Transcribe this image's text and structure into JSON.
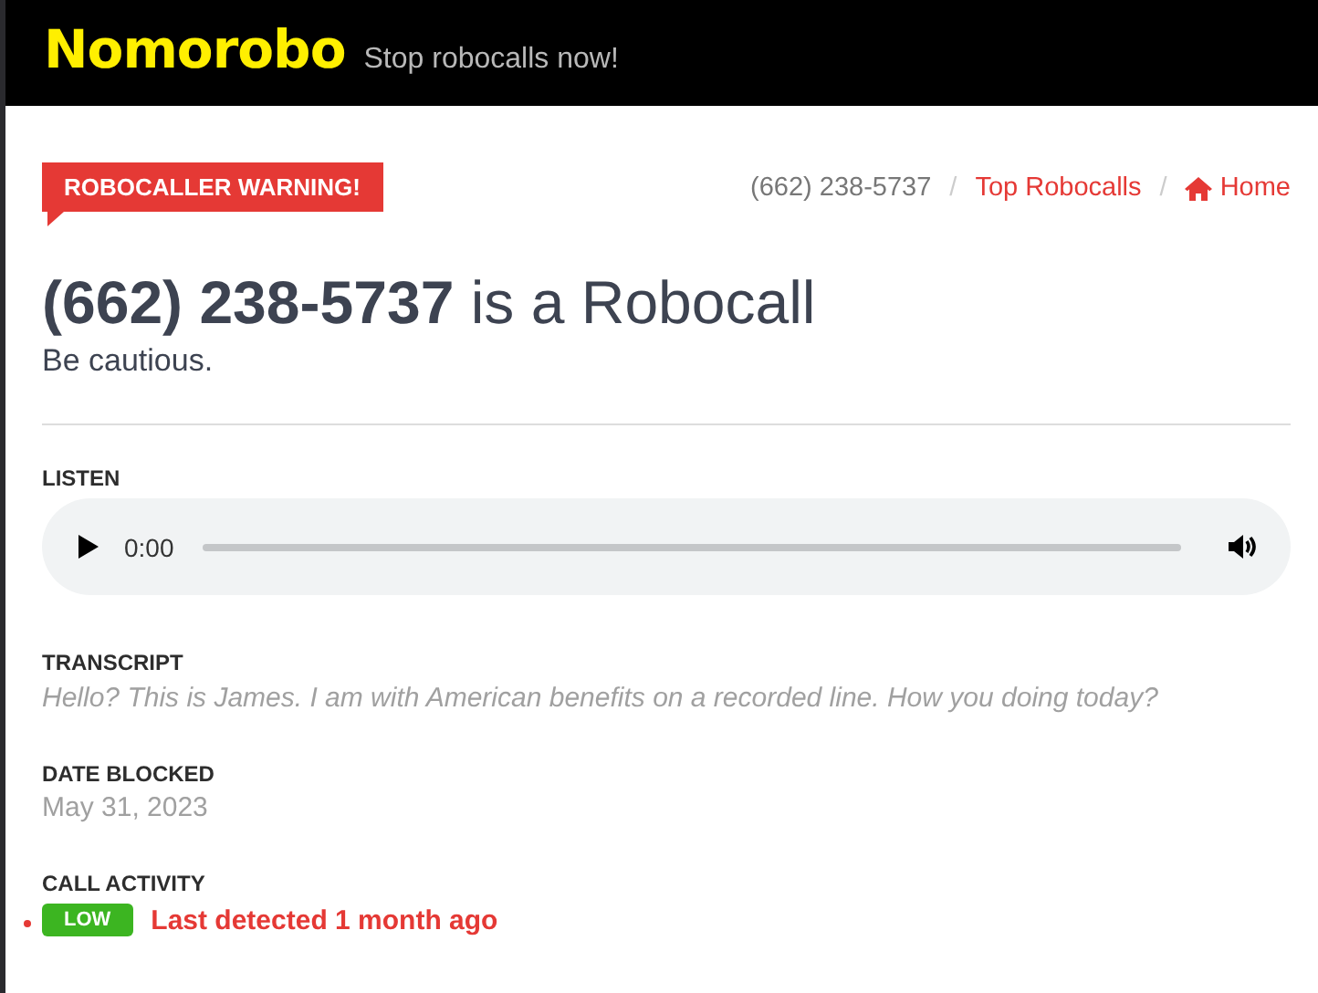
{
  "header": {
    "logo": "Nomorobo",
    "tagline": "Stop robocalls now!"
  },
  "warning_badge": "ROBOCALLER WARNING!",
  "breadcrumb": [
    {
      "label": "(662) 238-5737",
      "kind": "current"
    },
    {
      "label": "Top Robocalls",
      "kind": "link",
      "separator": "/"
    },
    {
      "label": "Home",
      "kind": "home",
      "separator": "/"
    }
  ],
  "title": {
    "number": "(662) 238-5737",
    "suffix": "is a Robocall"
  },
  "subtitle": "Be cautious.",
  "listen": {
    "label": "LISTEN",
    "time": "0:00"
  },
  "transcript": {
    "label": "TRANSCRIPT",
    "text": "Hello? This is James. I am with American benefits on a recorded line. How you doing today?"
  },
  "date_blocked": {
    "label": "DATE BLOCKED",
    "value": "May 31, 2023"
  },
  "call_activity": {
    "label": "CALL ACTIVITY",
    "badge": "LOW",
    "detail": "Last detected 1 month ago"
  }
}
